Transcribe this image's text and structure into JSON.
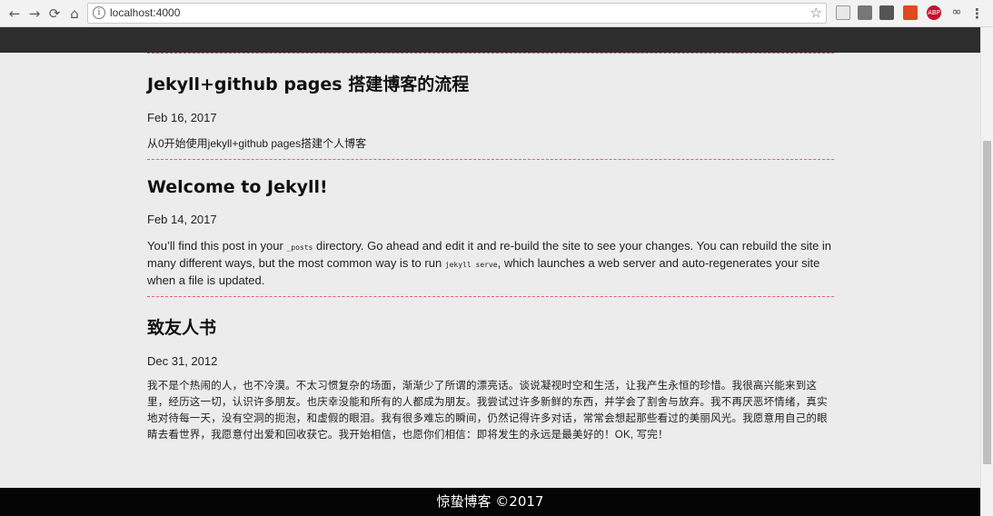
{
  "browser": {
    "url": "localhost:4000",
    "info_glyph": "i",
    "back_glyph": "←",
    "forward_glyph": "→",
    "reload_glyph": "⟳",
    "home_glyph": "⌂",
    "star_glyph": "☆",
    "menu_glyph": "⋮",
    "abp_label": "ABP",
    "extension_icons": [
      "reader-mode-icon",
      "cast-icon",
      "extensions-icon",
      "office-icon",
      "adblock-plus-icon",
      "glasses-icon"
    ]
  },
  "posts": [
    {
      "title": "Jekyll+github pages 搭建博客的流程",
      "date": "Feb 16, 2017",
      "excerpt": "从0开始使用jekyll+github pages搭建个人博客"
    },
    {
      "title": "Welcome to Jekyll!",
      "date": "Feb 14, 2017",
      "excerpt_part1": "You’ll find this post in your ",
      "excerpt_code1": "_posts",
      "excerpt_part2": " directory. Go ahead and edit it and re-build the site to see your changes. You can rebuild the site in many different ways, but the most common way is to run ",
      "excerpt_code2": "jekyll serve",
      "excerpt_part3": ", which launches a web server and auto-regenerates your site when a file is updated."
    },
    {
      "title": "致友人书",
      "date": "Dec 31, 2012",
      "excerpt": "我不是个热闹的人，也不冷漠。不太习惯复杂的场面，渐渐少了所谓的漂亮话。谈说凝视时空和生活，让我产生永恒的珍惜。我很高兴能来到这里，经历这一切，认识许多朋友。也庆幸没能和所有的人都成为朋友。我尝试过许多新鲜的东西，并学会了割舍与放弃。我不再厌恶坏情绪，真实地对待每一天，没有空洞的扼泡，和虚假的眼泪。我有很多难忘的瞬间，仍然记得许多对话，常常会想起那些看过的美丽风光。我愿意用自己的眼睛去看世界，我愿意付出爱和回收获它。我开始相信，也愿你们相信：即将发生的永远是最美好的！OK, 写完！"
    }
  ],
  "footer": {
    "text": "惊蛰博客 ©2017"
  }
}
